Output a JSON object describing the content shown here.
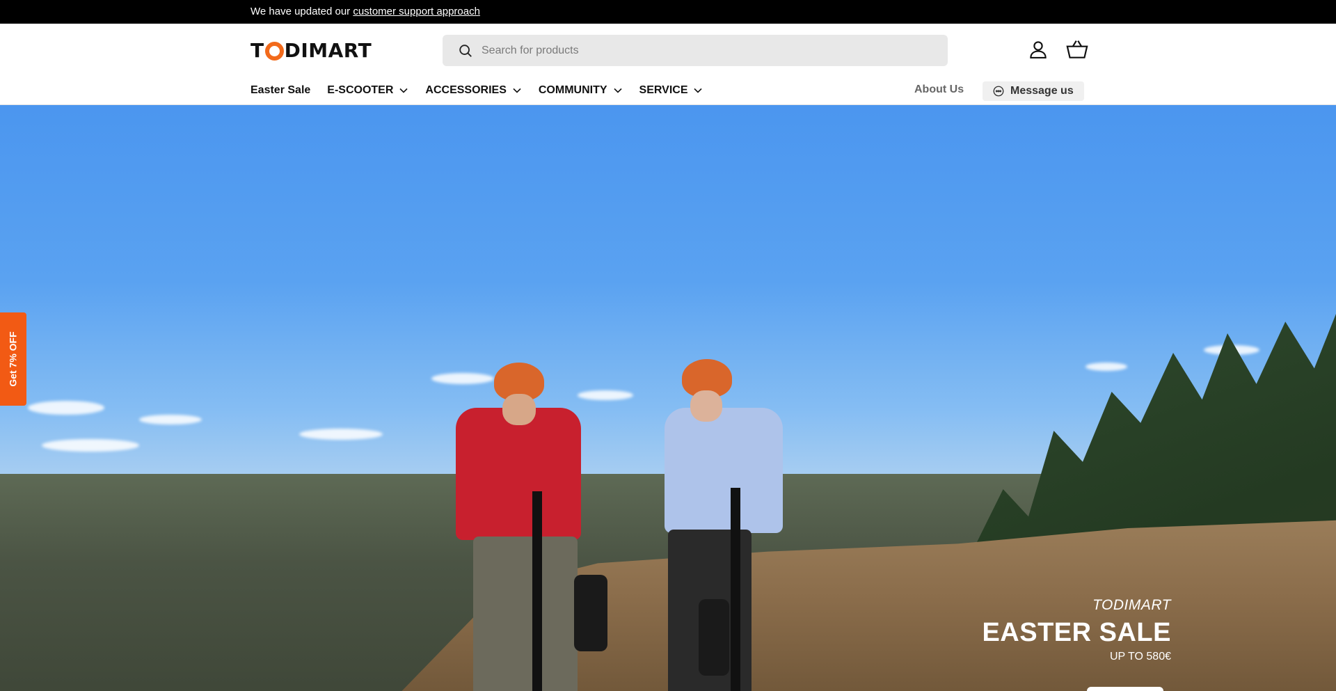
{
  "announcement": {
    "text": "We have updated our ",
    "link": "customer support approach"
  },
  "header": {
    "logo": {
      "part1": "T",
      "part2": "DIMART"
    },
    "search": {
      "placeholder": "Search for products"
    },
    "account_icon": "user-icon",
    "cart_icon": "basket-icon"
  },
  "nav": {
    "items": [
      {
        "label": "Easter Sale",
        "prefix": "",
        "has_dropdown": false
      },
      {
        "label": "E-SCOOTER",
        "has_dropdown": true
      },
      {
        "label": "ACCESSORIES",
        "has_dropdown": true
      },
      {
        "label": "COMMUNITY",
        "has_dropdown": true
      },
      {
        "label": "SERVICE",
        "has_dropdown": true
      }
    ],
    "about": "About Us",
    "message": "Message us"
  },
  "side_tab": {
    "label": "Get 7% OFF"
  },
  "hero": {
    "brand": "TODIMART",
    "title": "EASTER SALE",
    "subtitle": "UP TO 580€"
  },
  "colors": {
    "accent": "#f26a1b",
    "side_tab": "#f25a14",
    "announce_bg": "#000000"
  }
}
